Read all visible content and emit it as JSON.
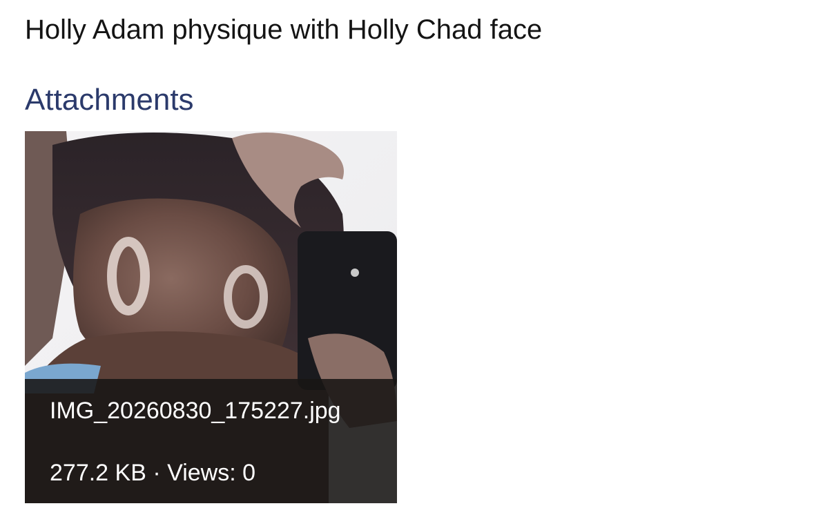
{
  "post": {
    "text": "Holly Adam physique with Holly Chad face"
  },
  "attachments": {
    "heading": "Attachments",
    "items": [
      {
        "filename": "IMG_20260830_175227.jpg",
        "size": "277.2 KB",
        "separator": "·",
        "views_label": "Views:",
        "views": "0"
      }
    ]
  }
}
